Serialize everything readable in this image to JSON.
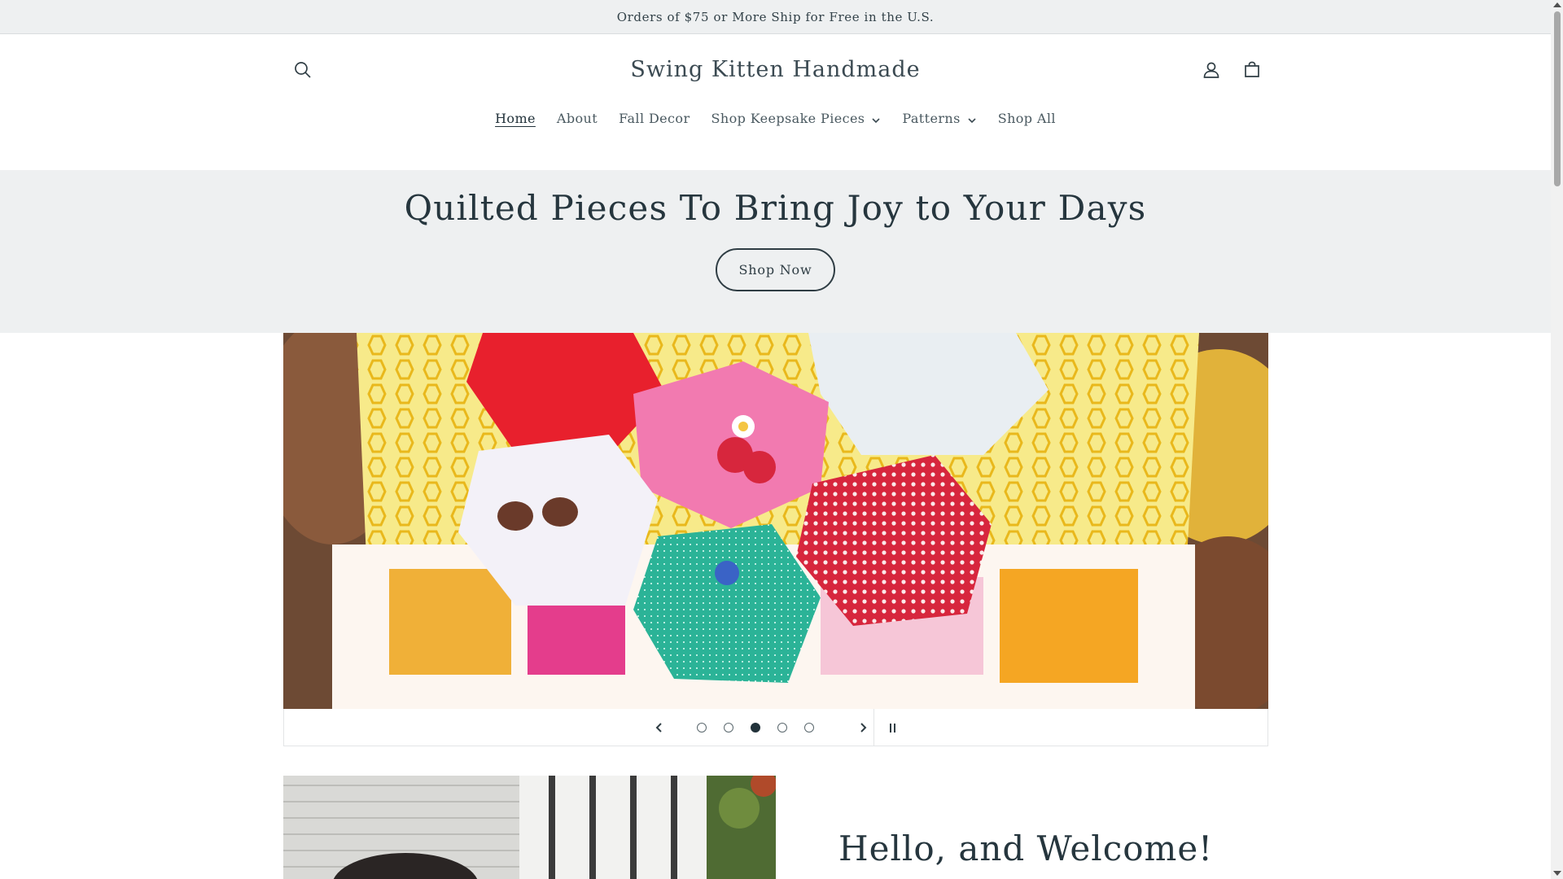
{
  "announcement": {
    "text": "Orders of $75 or More Ship for Free in the U.S."
  },
  "header": {
    "logo": "Swing Kitten Handmade",
    "icons": {
      "search": "search-icon",
      "account": "account-icon",
      "cart": "cart-icon"
    }
  },
  "nav": {
    "items": [
      {
        "label": "Home",
        "active": true,
        "dropdown": false
      },
      {
        "label": "About",
        "active": false,
        "dropdown": false
      },
      {
        "label": "Fall Decor",
        "active": false,
        "dropdown": false
      },
      {
        "label": "Shop Keepsake Pieces",
        "active": false,
        "dropdown": true
      },
      {
        "label": "Patterns",
        "active": false,
        "dropdown": true
      },
      {
        "label": "Shop All",
        "active": false,
        "dropdown": false
      }
    ]
  },
  "banner": {
    "heading": "Quilted Pieces To Bring Joy to Your Days",
    "button_label": "Shop Now"
  },
  "slideshow": {
    "slide_count": 5,
    "active_slide": 3,
    "icons": {
      "prev": "chevron-left-icon",
      "next": "chevron-right-icon",
      "pause": "pause-icon"
    }
  },
  "about": {
    "heading": "Hello, and Welcome!"
  },
  "colors": {
    "text": "#334249",
    "banner_bg": "#eef0f1",
    "heading": "#26363e"
  }
}
